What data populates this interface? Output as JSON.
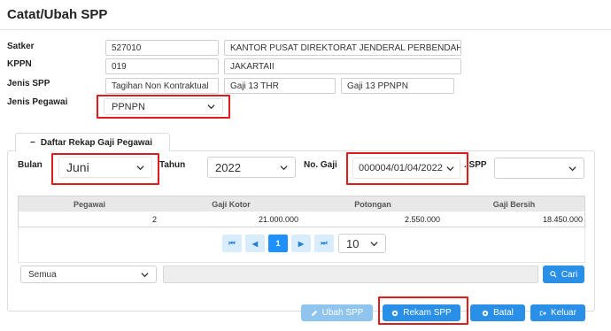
{
  "page": {
    "title": "Catat/Ubah SPP"
  },
  "form": {
    "satker_label": "Satker",
    "satker_code": "527010",
    "satker_name": "KANTOR PUSAT DIREKTORAT JENDERAL PERBENDAHARA",
    "kppn_label": "KPPN",
    "kppn_code": "019",
    "kppn_name": "JAKARTAII",
    "jenis_spp_label": "Jenis SPP",
    "jenis_spp_1": "Tagihan Non Kontraktual",
    "jenis_spp_2": "Gaji 13 THR",
    "jenis_spp_3": "Gaji 13  PPNPN",
    "jenis_pegawai_label": "Jenis Pegawai",
    "jenis_pegawai_value": "PPNPN"
  },
  "rekap": {
    "tab_label": "Daftar Rekap Gaji Pegawai",
    "tab_prefix": "−",
    "bulan_label": "Bulan",
    "bulan_value": "Juni",
    "tahun_label": "Tahun",
    "tahun_value": "2022",
    "nogaji_label": "No. Gaji",
    "nogaji_value": "000004/01/04/2022",
    "spp_label": ". SPP",
    "spp_value": ""
  },
  "table": {
    "headers": [
      "Pegawai",
      "Gaji Kotor",
      "Potongan",
      "Gaji Bersih"
    ],
    "rows": [
      [
        "2",
        "21.000.000",
        "2.550.000",
        "18.450.000"
      ]
    ]
  },
  "pagination": {
    "first": "⏮",
    "prev": "◀",
    "current": "1",
    "next": "▶",
    "last": "⏭",
    "page_size": "10"
  },
  "filter": {
    "scope_value": "Semua",
    "search_value": "",
    "search_button": "Cari"
  },
  "actions": {
    "ubah": "Ubah SPP",
    "rekam": "Rekam SPP",
    "batal": "Batal",
    "keluar": "Keluar"
  },
  "colors": {
    "accent": "#2a8fe6",
    "highlight": "#e01b1b",
    "disabled": "#8fc4ef"
  }
}
